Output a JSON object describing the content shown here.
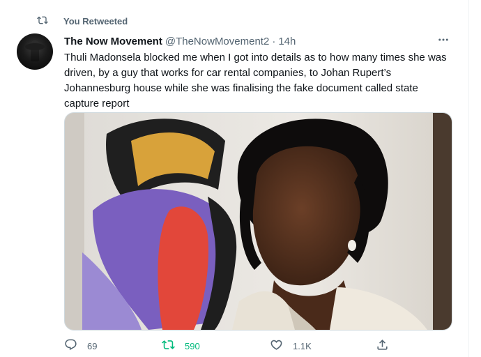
{
  "retweet": {
    "label": "You Retweeted",
    "icon": "retweet-icon"
  },
  "tweet": {
    "author_name": "The Now Movement",
    "author_handle": "@TheNowMovement2",
    "separator": "·",
    "time": "14h",
    "text": "Thuli Madonsela blocked me when I got into details as to how many times she was driven, by a guy that works for car rental companies, to Johan Rupert’s Johannesburg house while she was finalising the fake document called state capture report",
    "more_icon": "more-icon",
    "media": {
      "description_icon": "photo-image"
    }
  },
  "actions": {
    "reply": {
      "icon": "reply-icon",
      "count": "69"
    },
    "retweet": {
      "icon": "retweet-icon",
      "count": "590",
      "active_color": "#00ba7c"
    },
    "like": {
      "icon": "heart-icon",
      "count": "1.1K"
    },
    "share": {
      "icon": "share-icon"
    }
  },
  "colors": {
    "secondary_text": "#536471",
    "primary_text": "#0f1419",
    "retweet_green": "#00ba7c"
  }
}
